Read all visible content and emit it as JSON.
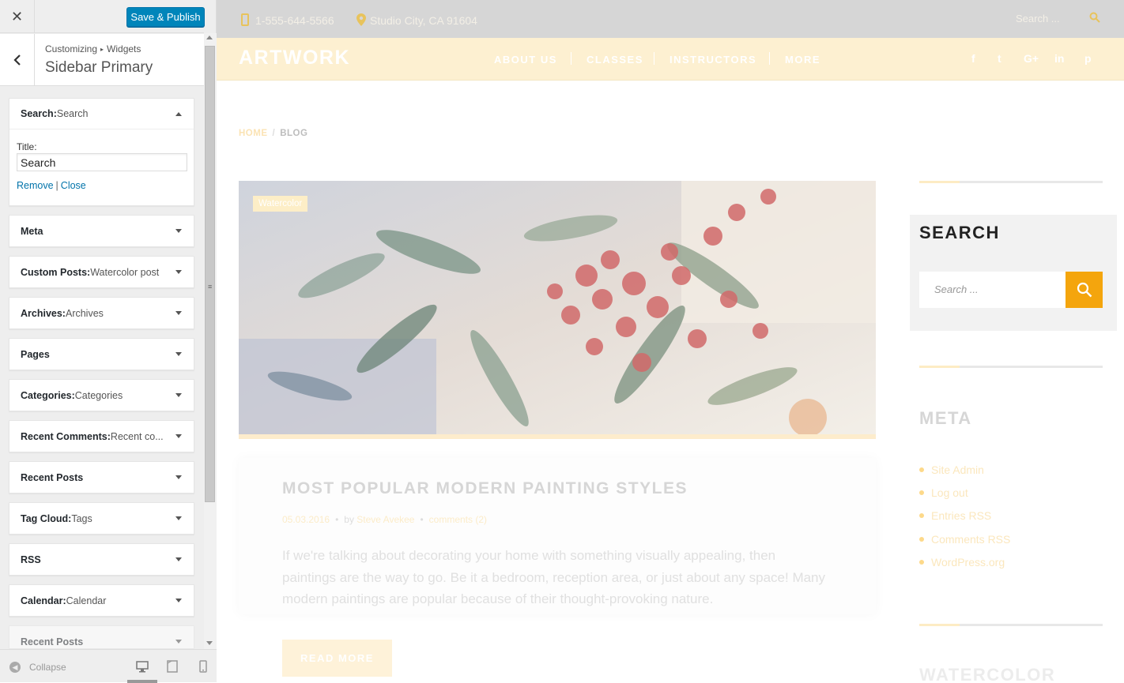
{
  "customizer": {
    "close_icon": "close-icon",
    "save_label": "Save & Publish",
    "breadcrumb": {
      "part1": "Customizing",
      "part2": "Widgets"
    },
    "section_title": "Sidebar Primary",
    "search_widget": {
      "label": "Search:",
      "sub": " Search",
      "title_label": "Title:",
      "title_value": "Search",
      "remove": "Remove",
      "separator": "|",
      "close": "Close"
    },
    "widgets": [
      {
        "label": "Meta",
        "sub": ""
      },
      {
        "label": "Custom Posts:",
        "sub": " Watercolor post"
      },
      {
        "label": "Archives:",
        "sub": " Archives"
      },
      {
        "label": "Pages",
        "sub": ""
      },
      {
        "label": "Categories:",
        "sub": " Categories"
      },
      {
        "label": "Recent Comments:",
        "sub": " Recent co..."
      },
      {
        "label": "Recent Posts",
        "sub": ""
      },
      {
        "label": "Tag Cloud:",
        "sub": " Tags"
      },
      {
        "label": "RSS",
        "sub": ""
      },
      {
        "label": "Calendar:",
        "sub": " Calendar"
      },
      {
        "label": "Recent Posts",
        "sub": ""
      }
    ],
    "collapse_label": "Collapse"
  },
  "site": {
    "phone": "1-555-644-5566",
    "address": "Studio City, CA 91604",
    "search_placeholder": "Search ...",
    "logo": "ARTWORK",
    "nav": [
      "ABOUT US",
      "CLASSES",
      "INSTRUCTORS",
      "MORE"
    ],
    "social": [
      "f",
      "t",
      "G+",
      "in",
      "p"
    ],
    "breadcrumb": {
      "home": "HOME",
      "sep": "/",
      "current": "BLOG"
    },
    "post": {
      "tag": "Watercolor",
      "title": "MOST POPULAR MODERN PAINTING STYLES",
      "date": "05.03.2016",
      "by": "by",
      "author": "Steve Avekee",
      "comments": "comments (2)",
      "excerpt": "If we're talking about decorating your home with something visually appealing, then paintings are the way to go. Be it a bedroom, reception area, or just about any space! Many modern paintings are popular because of their thought-provoking nature.",
      "read_more": "READ MORE"
    },
    "sidebar": {
      "search_title": "SEARCH",
      "search_placeholder": "Search ...",
      "meta_title": "META",
      "meta_items": [
        "Site Admin",
        "Log out",
        "Entries RSS",
        "Comments RSS",
        "WordPress.org"
      ],
      "watercolor_title": "WATERCOLOR"
    }
  },
  "colors": {
    "accent_orange": "#f4a50d",
    "wp_blue": "#0085ba",
    "nav_bg": "#fdf0d1"
  }
}
